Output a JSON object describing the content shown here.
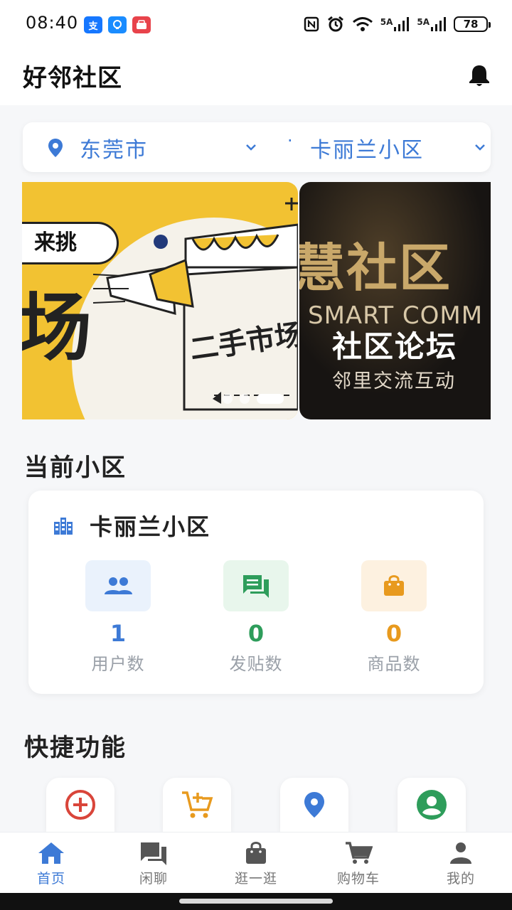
{
  "status_bar": {
    "time": "08:40",
    "network_label_1": "5A",
    "network_label_2": "5A",
    "battery": "78"
  },
  "header": {
    "title": "好邻社区",
    "notification_icon": "bell-icon"
  },
  "location": {
    "city": "东莞市",
    "separator": "·",
    "community": "卡丽兰小区"
  },
  "banner": {
    "slide_a": {
      "tag": "来挑",
      "big_text": "场",
      "sign_text": "二手市场"
    },
    "slide_b": {
      "big_text": "慧社区",
      "english": "SMART COMM",
      "title": "社区论坛",
      "subtitle": "邻里交流互动"
    },
    "dots_total": 3,
    "active_dot": 3
  },
  "current_community": {
    "section_title": "当前小区",
    "name": "卡丽兰小区",
    "stats": [
      {
        "icon": "users-icon",
        "value": "1",
        "label": "用户数",
        "color": "#3d7ad6",
        "bg": "#eaf2fc"
      },
      {
        "icon": "chat-icon",
        "value": "0",
        "label": "发贴数",
        "color": "#2e9d5b",
        "bg": "#e8f6ec"
      },
      {
        "icon": "shopping-bag-icon",
        "value": "0",
        "label": "商品数",
        "color": "#e89a1e",
        "bg": "#fdf1e0"
      }
    ]
  },
  "quick_functions": {
    "section_title": "快捷功能",
    "items": [
      {
        "icon": "add-circle-icon",
        "color": "#d9453a"
      },
      {
        "icon": "cart-add-icon",
        "color": "#e89a1e"
      },
      {
        "icon": "location-pin-icon",
        "color": "#3d7ad6"
      },
      {
        "icon": "account-circle-icon",
        "color": "#2e9d5b"
      }
    ]
  },
  "bottom_nav": [
    {
      "label": "首页",
      "icon": "home-icon",
      "active": true
    },
    {
      "label": "闲聊",
      "icon": "forum-icon",
      "active": false
    },
    {
      "label": "逛一逛",
      "icon": "shopping-bag-icon",
      "active": false
    },
    {
      "label": "购物车",
      "icon": "cart-icon",
      "active": false
    },
    {
      "label": "我的",
      "icon": "person-icon",
      "active": false
    }
  ]
}
